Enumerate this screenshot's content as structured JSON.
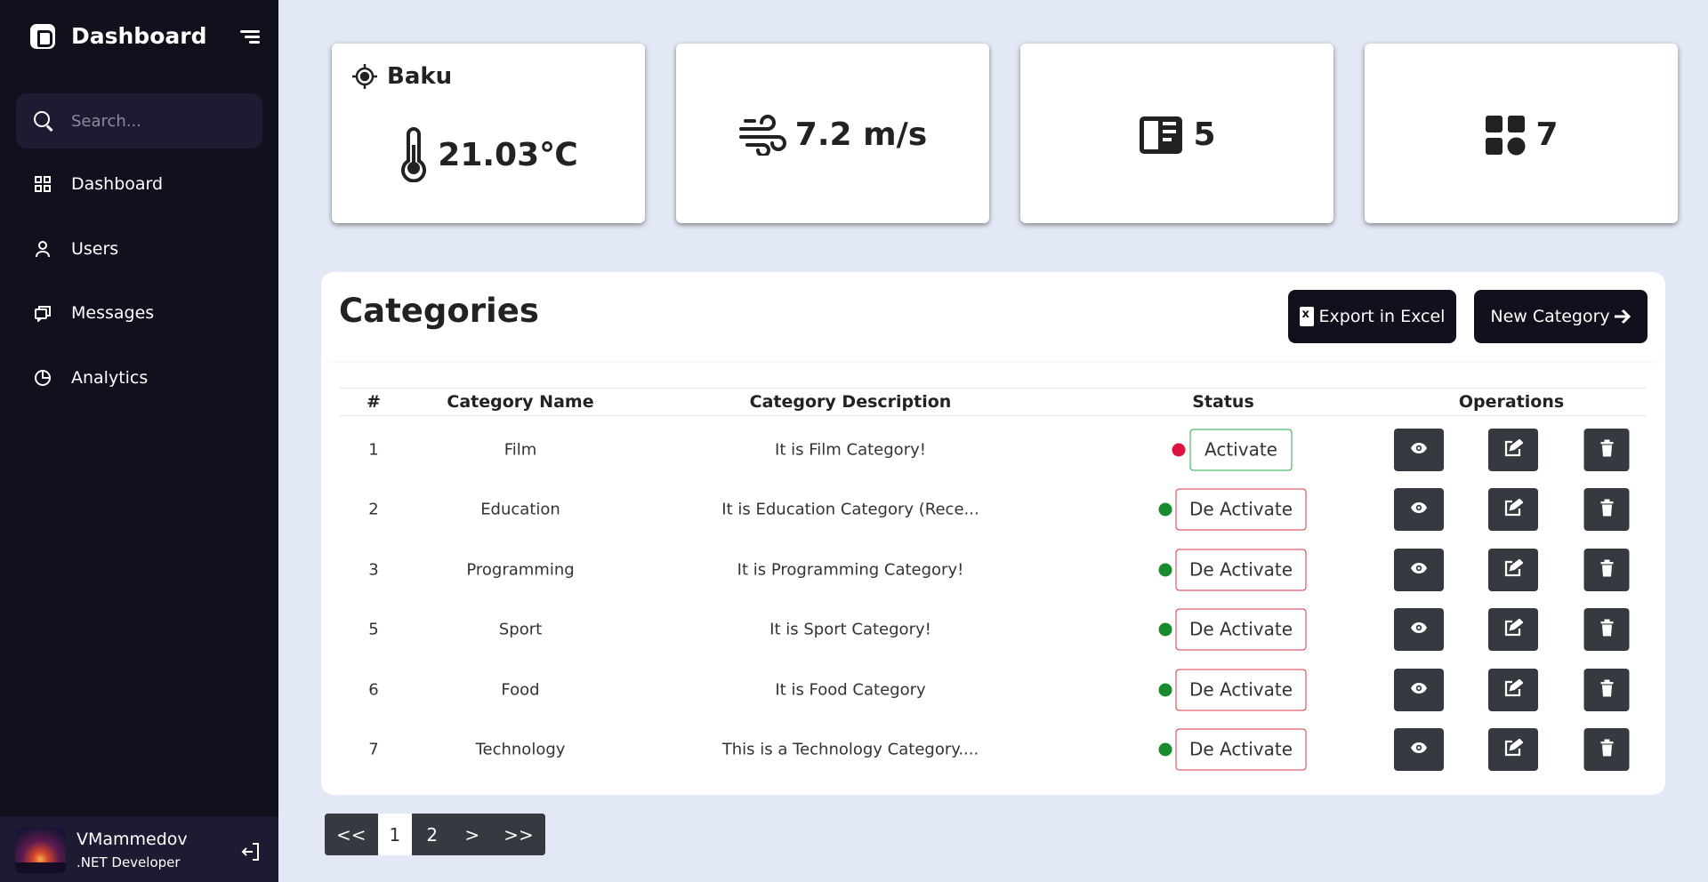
{
  "sidebar": {
    "brand": "Dashboard",
    "search_placeholder": "Search...",
    "items": [
      {
        "label": "Dashboard",
        "icon": "grid-icon"
      },
      {
        "label": "Users",
        "icon": "user-icon"
      },
      {
        "label": "Messages",
        "icon": "chat-icon"
      },
      {
        "label": "Analytics",
        "icon": "pie-chart-icon"
      }
    ],
    "profile": {
      "name": "VMammedov",
      "role": ".NET Developer"
    }
  },
  "stats": {
    "city": "Baku",
    "temperature": "21.03℃",
    "wind": "7.2 m/s",
    "articles": "5",
    "categories": "7"
  },
  "categories": {
    "title": "Categories",
    "export_label": "Export in Excel",
    "new_label": "New Category",
    "columns": [
      "#",
      "Category Name",
      "Category Description",
      "Status",
      "Operations"
    ],
    "rows": [
      {
        "id": "1",
        "name": "Film",
        "description": "It is Film Category!",
        "active": false,
        "action": "Activate"
      },
      {
        "id": "2",
        "name": "Education",
        "description": "It is Education Category (Rece...",
        "active": true,
        "action": "De Activate"
      },
      {
        "id": "3",
        "name": "Programming",
        "description": "It is Programming Category!",
        "active": true,
        "action": "De Activate"
      },
      {
        "id": "5",
        "name": "Sport",
        "description": "It is Sport Category!",
        "active": true,
        "action": "De Activate"
      },
      {
        "id": "6",
        "name": "Food",
        "description": "It is Food Category",
        "active": true,
        "action": "De Activate"
      },
      {
        "id": "7",
        "name": "Technology",
        "description": "This is a Technology Category....",
        "active": true,
        "action": "De Activate"
      }
    ]
  },
  "pagination": {
    "first": "<<",
    "pages": [
      "1",
      "2"
    ],
    "current": "1",
    "next": ">",
    "last": ">>"
  },
  "colors": {
    "sidebar_bg": "#11101d",
    "page_bg": "#e2e8f5",
    "active_dot": "#198b2e",
    "inactive_dot": "#dc143c",
    "activate_border": "#28a745",
    "deactivate_border": "#dc3545",
    "op_button": "#343a40"
  }
}
